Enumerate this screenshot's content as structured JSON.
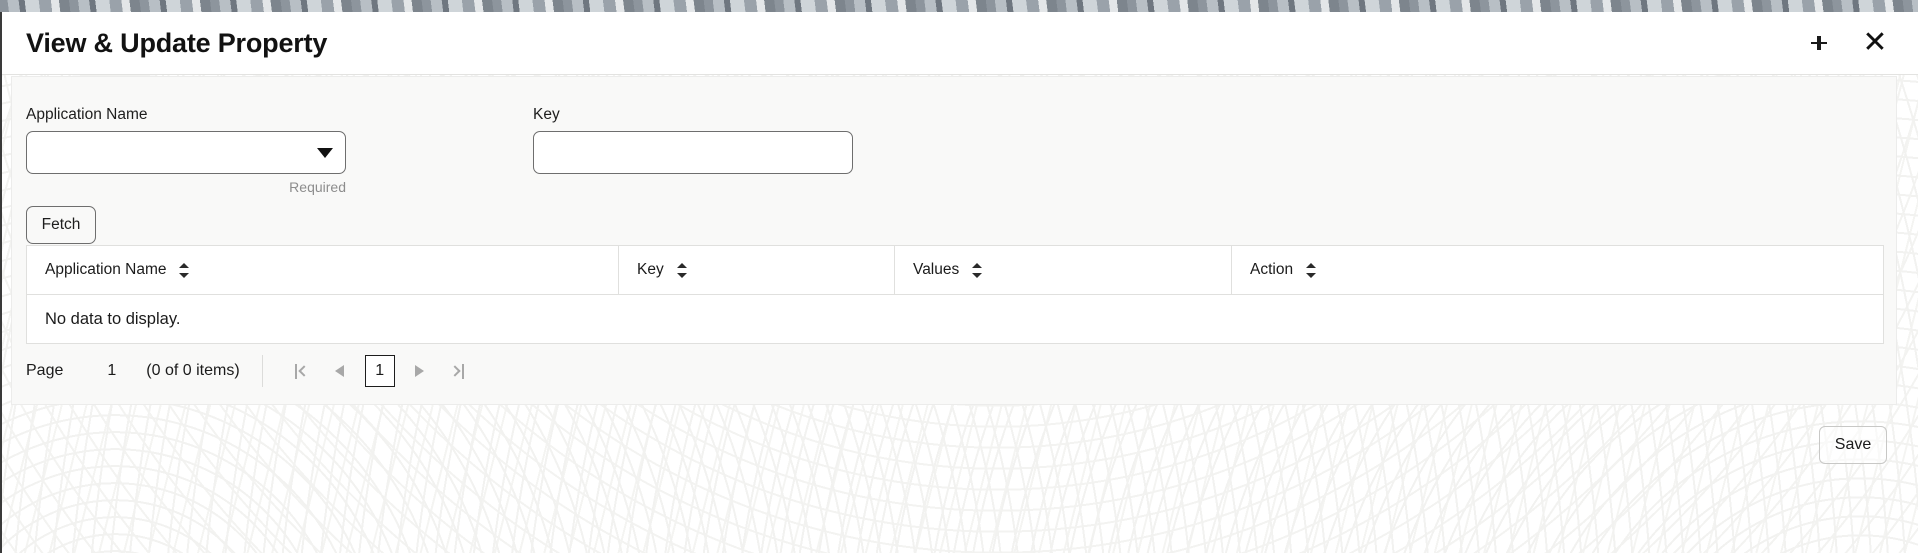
{
  "window": {
    "title": "View & Update Property",
    "collapse_icon": "collapse-icon",
    "close_icon": "close-icon",
    "close_glyph": "✕"
  },
  "form": {
    "application": {
      "label": "Application Name",
      "value": "",
      "placeholder": "",
      "required_note": "Required",
      "caret_icon": "chevron-down-icon"
    },
    "key": {
      "label": "Key",
      "value": "",
      "placeholder": ""
    },
    "fetch_label": "Fetch"
  },
  "grid": {
    "columns": [
      {
        "label": "Application Name",
        "sort_icon": "sort-icon"
      },
      {
        "label": "Key",
        "sort_icon": "sort-icon"
      },
      {
        "label": "Values",
        "sort_icon": "sort-icon"
      },
      {
        "label": "Action",
        "sort_icon": "sort-icon"
      }
    ],
    "rows": [],
    "empty_message": "No data to display."
  },
  "pager": {
    "page_label": "Page",
    "page_number": "1",
    "items_text": "(0 of 0 items)",
    "first_icon": "first-page-icon",
    "prev_icon": "previous-page-icon",
    "next_icon": "next-page-icon",
    "last_icon": "last-page-icon",
    "current_page": "1"
  },
  "footer": {
    "save_label": "Save"
  },
  "colors": {
    "panel": "#f9f9f8",
    "border": "#6e6e6e",
    "grid_border": "#e0e0de",
    "muted_text": "#8d8d8d",
    "text": "#1b1b1b"
  }
}
